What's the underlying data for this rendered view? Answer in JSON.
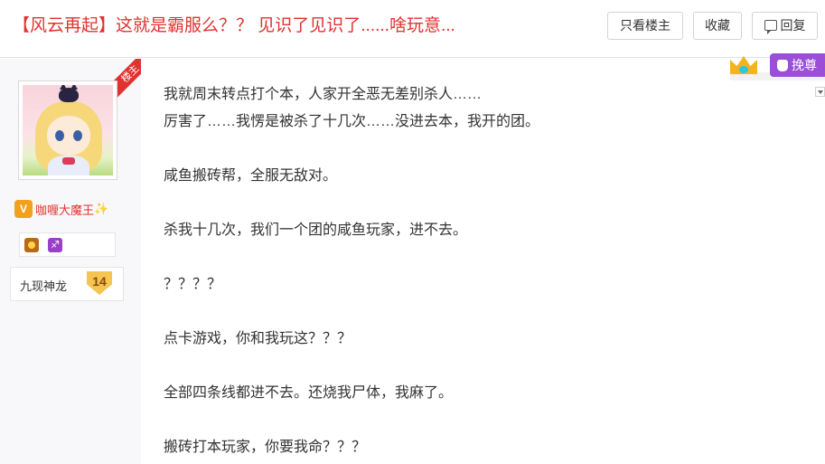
{
  "thread": {
    "title": "【风云再起】这就是霸服么？？ 见识了见识了......啥玩意..."
  },
  "toolbar": {
    "only_op_label": "只看楼主",
    "favorite_label": "收藏",
    "reply_label": "回复"
  },
  "author": {
    "floor_tag": "楼主",
    "username": "咖喱大魔王",
    "sparkle": "✨",
    "level_name": "九现神龙",
    "level_number": "14"
  },
  "vote": {
    "label": "挽尊"
  },
  "post": {
    "lines": [
      "我就周末转点打个本，人家开全恶无差别杀人……",
      "厉害了……我愣是被杀了十几次……没进去本，我开的团。",
      "",
      "咸鱼搬砖帮，全服无敌对。",
      "",
      "杀我十几次，我们一个团的咸鱼玩家，进不去。",
      "",
      "？？？？",
      "",
      "点卡游戏，你和我玩这？？？",
      "",
      "全部四条线都进不去。还烧我尸体，我麻了。",
      "",
      "搬砖打本玩家，你要我命？？？"
    ]
  },
  "colors": {
    "accent_red": "#e0322f",
    "vote_purple": "#9a4fd6",
    "sidebar_bg": "#f8f8fa"
  }
}
